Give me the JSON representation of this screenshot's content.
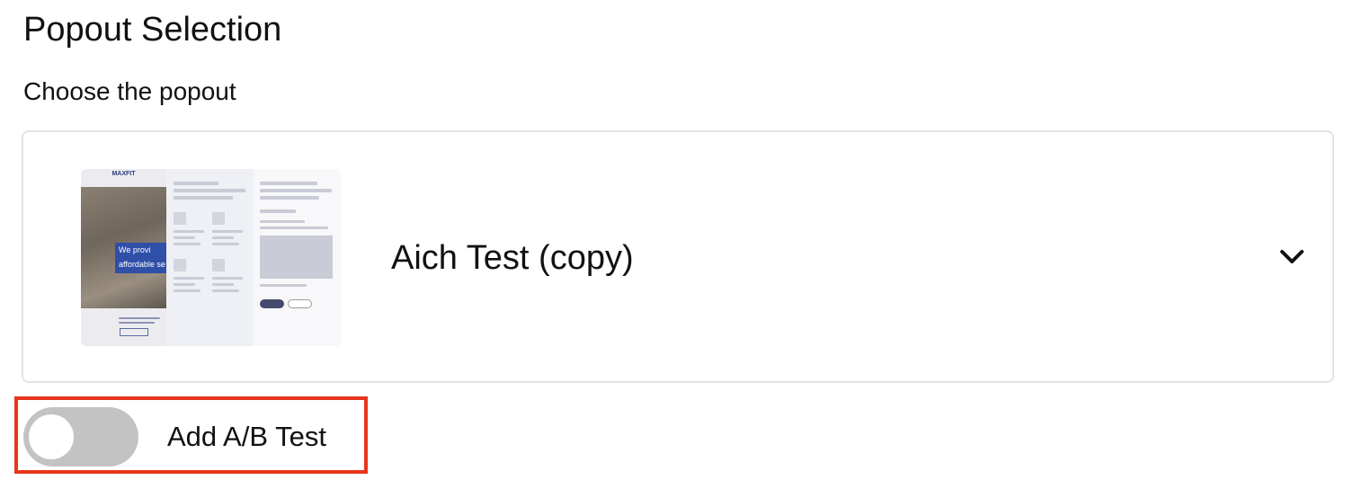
{
  "section": {
    "title": "Popout Selection",
    "subtitle": "Choose the popout"
  },
  "popout_select": {
    "selected_value": "Aich Test (copy)",
    "thumbnail": {
      "logo_text": "MAXFIT",
      "banner_text_line1": "We provi",
      "banner_text_line2": "affordable se"
    },
    "expand_icon": "chevron-down-icon"
  },
  "ab_test": {
    "label": "Add A/B Test",
    "enabled": false
  },
  "colors": {
    "highlight": "#e8341c",
    "toggle_off": "#c3c3c3",
    "card_border": "#e3e3e3"
  }
}
